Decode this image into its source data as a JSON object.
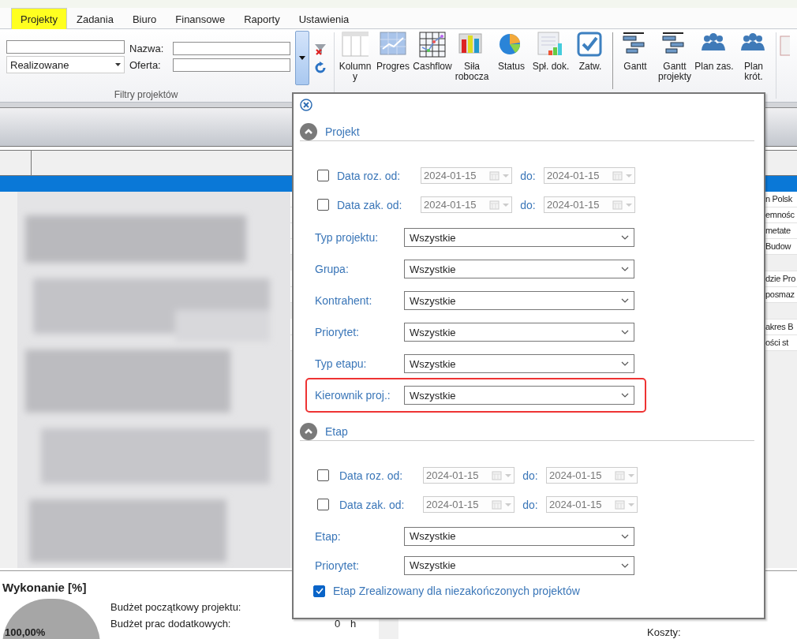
{
  "tabs": [
    {
      "label": "Projekty",
      "selected": true
    },
    {
      "label": "Zadania",
      "selected": false
    },
    {
      "label": "Biuro",
      "selected": false
    },
    {
      "label": "Finansowe",
      "selected": false
    },
    {
      "label": "Raporty",
      "selected": false
    },
    {
      "label": "Ustawienia",
      "selected": false
    }
  ],
  "filters": {
    "status_combo": {
      "value": "Realizowane"
    },
    "fields": [
      {
        "label": "Nazwa:"
      },
      {
        "label": "Oferta:"
      }
    ],
    "group_label": "Filtry projektów"
  },
  "ribbon_buttons": [
    {
      "label": "Kolumny",
      "kind": "columns"
    },
    {
      "label": "Progres",
      "kind": "progress"
    },
    {
      "label": "Cashflow",
      "kind": "cashflow"
    },
    {
      "label": "Siła robocza",
      "kind": "bars"
    },
    {
      "label": "Status",
      "kind": "pie"
    },
    {
      "label": "Spł. dok.",
      "kind": "sheet"
    },
    {
      "label": "Zatw.",
      "kind": "check"
    },
    {
      "label": "Gantt",
      "kind": "gantt"
    },
    {
      "label": "Gantt projekty",
      "kind": "gantt"
    },
    {
      "label": "Plan zas.",
      "kind": "people"
    },
    {
      "label": "Plan krót.",
      "kind": "people"
    }
  ],
  "grid": {
    "cells": [
      {
        "text": "n Polsk",
        "gap_before": false
      },
      {
        "text": "emnośc",
        "gap_before": false
      },
      {
        "text": "metate",
        "gap_before": false
      },
      {
        "text": "Budow",
        "gap_before": false
      },
      {
        "text": "dzie Pro",
        "gap_before": true
      },
      {
        "text": "posmaz",
        "gap_before": false
      },
      {
        "text": "akres B",
        "gap_before": true
      },
      {
        "text": "ości st",
        "gap_before": false
      }
    ]
  },
  "summary": {
    "title": "Wykonanie [%]",
    "pie_label": "100,00%",
    "rows": [
      {
        "label": "Budżet początkowy projektu:"
      },
      {
        "label": "Budżet prac dodatkowych:",
        "value": "0",
        "unit": "h"
      }
    ],
    "costs_label": "Koszty:"
  },
  "filter_popup": {
    "sections": [
      {
        "title": "Projekt",
        "expanded": true,
        "date_rows": [
          {
            "label": "Data roz. od:",
            "checked": false,
            "from": "2024-01-15",
            "to_label": "do:",
            "to": "2024-01-15"
          },
          {
            "label": "Data zak. od:",
            "checked": false,
            "from": "2024-01-15",
            "to_label": "do:",
            "to": "2024-01-15"
          }
        ],
        "combos": [
          {
            "label": "Typ projektu:",
            "value": "Wszystkie",
            "highlighted": false
          },
          {
            "label": "Grupa:",
            "value": "Wszystkie",
            "highlighted": false
          },
          {
            "label": "Kontrahent:",
            "value": "Wszystkie",
            "highlighted": false
          },
          {
            "label": "Priorytet:",
            "value": "Wszystkie",
            "highlighted": false
          },
          {
            "label": "Typ etapu:",
            "value": "Wszystkie",
            "highlighted": false
          },
          {
            "label": "Kierownik proj.:",
            "value": "Wszystkie",
            "highlighted": true
          }
        ]
      },
      {
        "title": "Etap",
        "expanded": true,
        "date_rows": [
          {
            "label": "Data roz. od:",
            "checked": false,
            "from": "2024-01-15",
            "to_label": "do:",
            "to": "2024-01-15"
          },
          {
            "label": "Data zak. od:",
            "checked": false,
            "from": "2024-01-15",
            "to_label": "do:",
            "to": "2024-01-15"
          }
        ],
        "combos": [
          {
            "label": "Etap:",
            "value": "Wszystkie",
            "highlighted": false
          },
          {
            "label": "Priorytet:",
            "value": "Wszystkie",
            "highlighted": false
          }
        ]
      }
    ],
    "option": {
      "label": "Etap Zrealizowany dla niezakończonych projektów",
      "checked": true
    }
  }
}
